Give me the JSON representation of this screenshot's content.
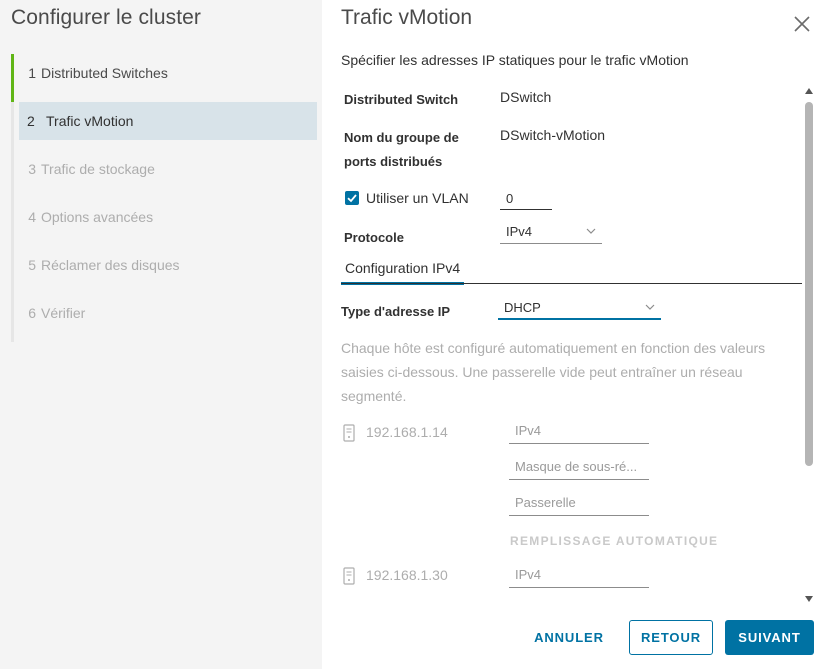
{
  "sidebar": {
    "title": "Configurer le cluster",
    "steps": [
      {
        "num": "1",
        "label": "Distributed Switches"
      },
      {
        "num": "2",
        "label": "Trafic vMotion"
      },
      {
        "num": "3",
        "label": "Trafic de stockage"
      },
      {
        "num": "4",
        "label": "Options avancées"
      },
      {
        "num": "5",
        "label": "Réclamer des disques"
      },
      {
        "num": "6",
        "label": "Vérifier"
      }
    ]
  },
  "main": {
    "title": "Trafic vMotion",
    "subtitle": "Spécifier les adresses IP statiques pour le trafic vMotion",
    "distributed_switch_label": "Distributed Switch",
    "distributed_switch_value": "DSwitch",
    "port_group_label_line1": "Nom du groupe de",
    "port_group_label_line2": "ports distribués",
    "port_group_value": "DSwitch-vMotion",
    "vlan_label": "Utiliser un VLAN",
    "vlan_value": "0",
    "protocol_label": "Protocole",
    "protocol_value": "IPv4",
    "tab_label": "Configuration IPv4",
    "ip_type_label": "Type d'adresse IP",
    "ip_type_value": "DHCP",
    "help_text": "Chaque hôte est configuré automatiquement en fonction des valeurs saisies ci-dessous. Une passerelle vide peut entraîner un réseau segmenté.",
    "hosts": [
      {
        "name": "192.168.1.14",
        "ipv4_placeholder": "IPv4",
        "mask_placeholder": "Masque de sous-ré...",
        "gateway_placeholder": "Passerelle",
        "autofill": "REMPLISSAGE AUTOMATIQUE"
      },
      {
        "name": "192.168.1.30",
        "ipv4_placeholder": "IPv4"
      }
    ]
  },
  "footer": {
    "cancel": "ANNULER",
    "back": "RETOUR",
    "next": "SUIVANT"
  },
  "colors": {
    "accent": "#0072a3",
    "done": "#60b515",
    "active_step_bg": "#d8e3e9",
    "disabled_text": "#adadad"
  }
}
